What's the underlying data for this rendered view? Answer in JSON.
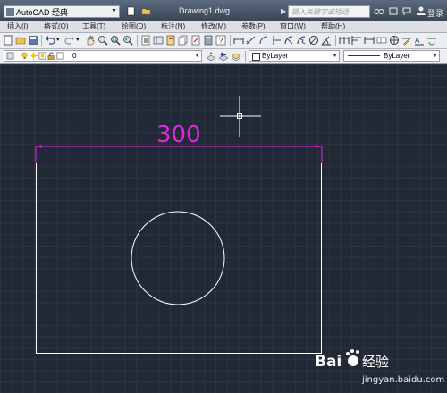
{
  "titlebar": {
    "workspace": "AutoCAD 经典",
    "document_title": "Drawing1.dwg",
    "search_placeholder": "键入关键字或短语",
    "login_label": "登录"
  },
  "menubar": {
    "items": [
      "插入(I)",
      "格式(O)",
      "工具(T)",
      "绘图(D)",
      "标注(N)",
      "修改(M)",
      "参数(P)",
      "窗口(W)",
      "帮助(H)"
    ]
  },
  "layer_toolbar": {
    "current_layer": "0",
    "color": "ByLayer",
    "linetype": "ByLayer"
  },
  "drawing": {
    "dimension_value": "300",
    "dimension_color": "#e025e0",
    "geometry_color": "#ffffff",
    "cursor": "crosshair-pickbox"
  },
  "watermark": {
    "brand": "Bai 经验",
    "url": "jingyan.baidu.com"
  },
  "colors": {
    "canvas_bg": "#222936",
    "grid": "#2c3441",
    "toolbar_bg": "#eceef1"
  }
}
